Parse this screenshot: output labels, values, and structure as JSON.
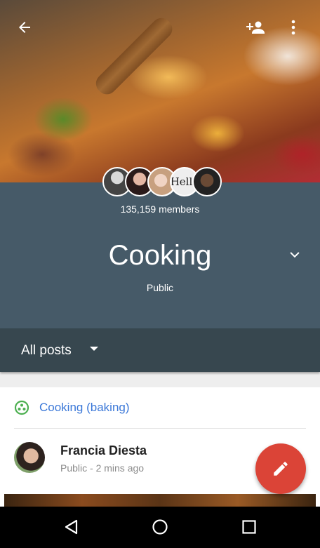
{
  "group": {
    "members_count": "135,159 members",
    "name": "Cooking",
    "privacy": "Public",
    "avatar_text": "Hello"
  },
  "filter": {
    "label": "All posts"
  },
  "post": {
    "category": "Cooking (baking)",
    "author_name": "Francia Diesta",
    "meta": "Public - 2 mins ago"
  },
  "icons": {
    "back": "arrow-back-icon",
    "add_member": "person-add-icon",
    "more": "more-vert-icon",
    "expand": "chevron-down-icon",
    "dropdown": "caret-down-icon",
    "category": "community-icon",
    "compose": "pencil-icon",
    "nav_back": "triangle-back-icon",
    "nav_home": "circle-home-icon",
    "nav_recents": "square-recents-icon"
  },
  "colors": {
    "header_bg": "#465a68",
    "filter_bg": "#37474f",
    "link": "#3b78d8",
    "fab": "#db4437",
    "category_icon": "#4caf50"
  }
}
